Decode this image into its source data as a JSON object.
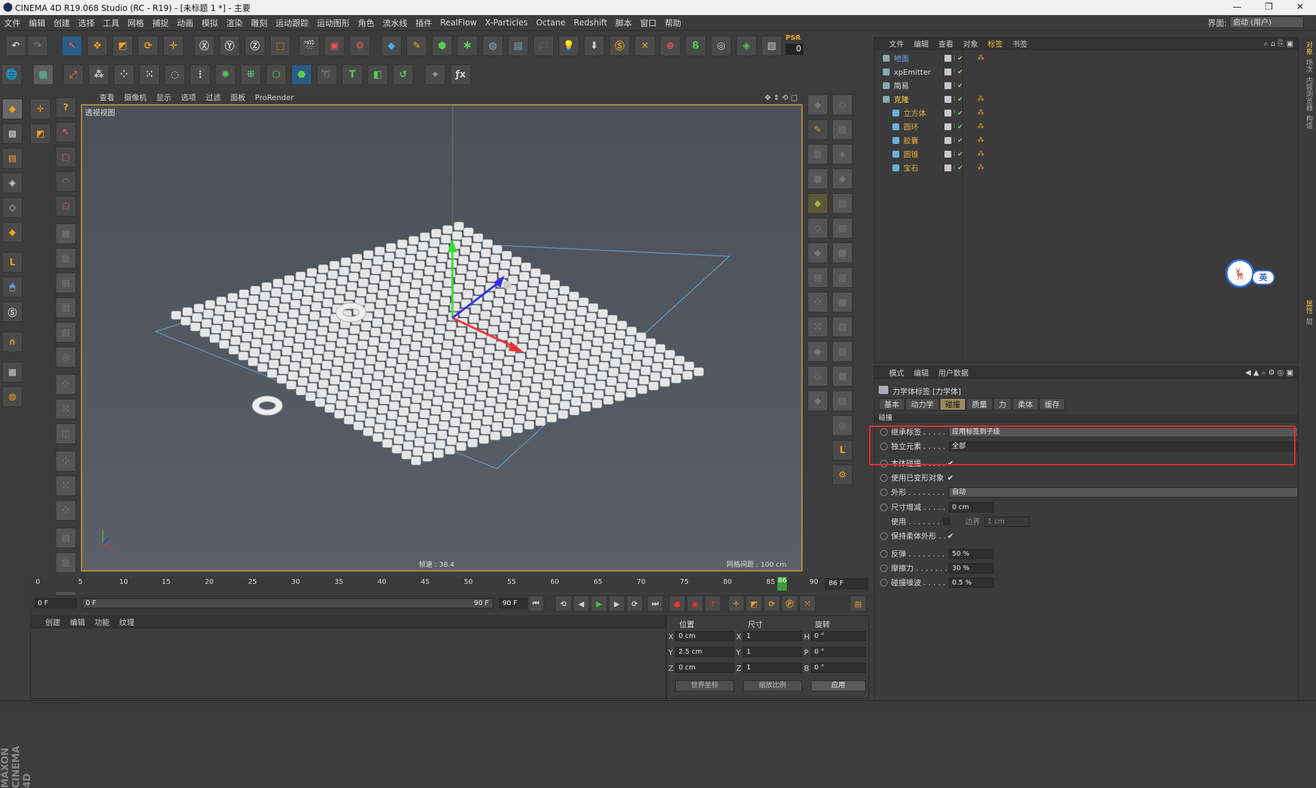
{
  "window": {
    "title": "CINEMA 4D R19.068 Studio (RC - R19) - [未标题 1 *] - 主要"
  },
  "menubar": {
    "items": [
      "文件",
      "编辑",
      "创建",
      "选择",
      "工具",
      "网格",
      "捕捉",
      "动画",
      "模拟",
      "渲染",
      "雕刻",
      "运动跟踪",
      "运动图形",
      "角色",
      "流水线",
      "插件",
      "RealFlow",
      "X-Particles",
      "Octane",
      "Redshift",
      "脚本",
      "窗口",
      "帮助"
    ],
    "layout_label": "界面:",
    "layout_value": "启动 (用户)"
  },
  "toolbar": {
    "psr_label": "PSR",
    "psr_value": "0"
  },
  "viewport": {
    "menu": [
      "查看",
      "摄像机",
      "显示",
      "选项",
      "过滤",
      "面板",
      "ProRender"
    ],
    "label": "透视视图",
    "fps": "帧速 : 38.4",
    "grid_distance": "网格间距 : 100 cm"
  },
  "object_manager": {
    "menu": [
      "文件",
      "编辑",
      "查看",
      "对象",
      "标签",
      "书签"
    ],
    "objects": [
      {
        "name": "地面",
        "color": "#7aa0ff",
        "indent": 0
      },
      {
        "name": "xpEmitter",
        "color": "#dddddd",
        "indent": 0
      },
      {
        "name": "简易",
        "color": "#dddddd",
        "indent": 0
      },
      {
        "name": "克隆",
        "color": "#ffd84a",
        "indent": 0
      },
      {
        "name": "立方体",
        "color": "#e0b040",
        "indent": 1
      },
      {
        "name": "圆环",
        "color": "#e0b040",
        "indent": 1
      },
      {
        "name": "胶囊",
        "color": "#e0b040",
        "indent": 1
      },
      {
        "name": "圆锥",
        "color": "#e0b040",
        "indent": 1
      },
      {
        "name": "宝石",
        "color": "#e0b040",
        "indent": 1
      }
    ]
  },
  "ime_badge": {
    "text": "英"
  },
  "attribute_manager": {
    "menu": [
      "模式",
      "编辑",
      "用户数据"
    ],
    "tag_title": "力学体标签 [力学体]",
    "tabs": [
      "基本",
      "动力学",
      "碰撞",
      "质量",
      "力",
      "柔体",
      "缓存"
    ],
    "active_tab": "碰撞",
    "section": "碰撞",
    "rows": {
      "inherit_label": "继承标签 . . . . . . .",
      "inherit_value": "应用标签到子级",
      "independent_label": "独立元素 . . . . . . .",
      "independent_value": "全部",
      "self_collision_label": "本体碰撞 . . . . . . .",
      "use_deformed_label": "使用已变形对象",
      "shape_label": "外形 . . . . . . . . . . .",
      "shape_value": "自动",
      "size_inc_label": "尺寸增减 . . . . . . .",
      "size_inc_value": "0 cm",
      "use_label": "使用 . . . . . . . . . .",
      "margin_label": "边界",
      "margin_value": "1 cm",
      "keep_shape_label": "保持柔体外形 . .",
      "bounce_label": "反弹 . . . . . . . . . . .",
      "bounce_value": "50 %",
      "friction_label": "摩擦力 . . . . . . . . .",
      "friction_value": "30 %",
      "noise_label": "碰撞噪波 . . . . . . .",
      "noise_value": "0.5 %"
    }
  },
  "timeline": {
    "ticks": [
      "0",
      "5",
      "10",
      "15",
      "20",
      "25",
      "30",
      "35",
      "40",
      "45",
      "50",
      "55",
      "60",
      "65",
      "70",
      "75",
      "80",
      "85",
      "86",
      "90"
    ],
    "end_field": "86 F",
    "current_frame": "0 F",
    "range_start": "0 F",
    "range_end": "90 F",
    "max_field": "90 F"
  },
  "material_manager": {
    "menu": [
      "创建",
      "编辑",
      "功能",
      "纹理"
    ]
  },
  "coordinates": {
    "headers": [
      "位置",
      "尺寸",
      "旋转"
    ],
    "rows": [
      {
        "a_lbl": "X",
        "a_val": "0 cm",
        "b_lbl": "X",
        "b_val": "1",
        "c_lbl": "H",
        "c_val": "0 °"
      },
      {
        "a_lbl": "Y",
        "a_val": "2.5 cm",
        "b_lbl": "Y",
        "b_val": "1",
        "c_lbl": "P",
        "c_val": "0 °"
      },
      {
        "a_lbl": "Z",
        "a_val": "0 cm",
        "b_lbl": "Z",
        "b_val": "1",
        "c_lbl": "B",
        "c_val": "0 °"
      }
    ],
    "world_btn": "世界坐标",
    "scale_btn": "缩放比例",
    "apply_btn": "应用"
  },
  "right_strip": [
    "对象",
    "场次",
    "内容浏览器",
    "构造"
  ],
  "attr_strip": [
    "属性",
    "层"
  ],
  "brand": "MAXON CINEMA 4D"
}
